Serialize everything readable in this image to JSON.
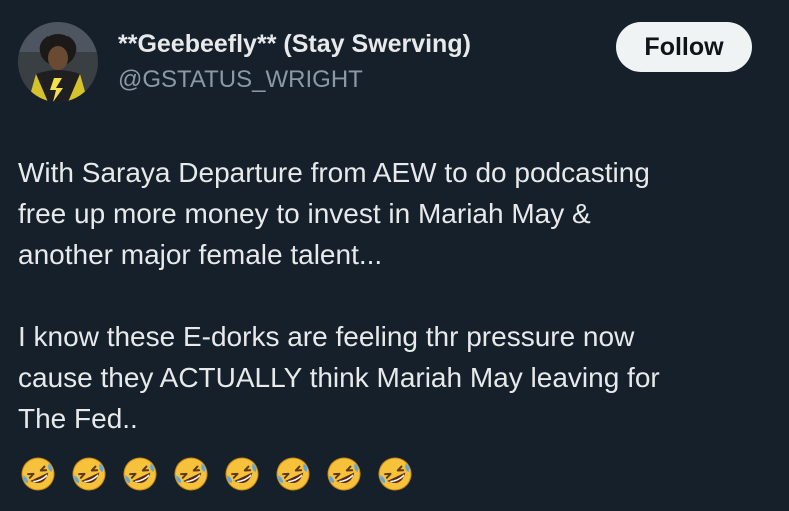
{
  "tweet": {
    "author": {
      "display_name": "**Geebeefly** (Stay Swerving)",
      "handle": "@GSTATUS_WRIGHT",
      "avatar_icon": "profile-avatar"
    },
    "follow_label": "Follow",
    "text_lines": [
      "With Saraya Departure from AEW to do podcasting",
      "free up more money to invest in Mariah May &",
      "another major female talent...",
      "",
      "I know these E-dorks are feeling thr pressure now",
      "cause they ACTUALLY think Mariah May leaving for",
      "The Fed.."
    ],
    "emoji": {
      "name": "rolling-on-the-floor-laughing",
      "count": 8
    }
  },
  "colors": {
    "background": "#16202b",
    "text_primary": "#e7e9ea",
    "text_secondary": "#8b98a5",
    "button_bg": "#eff3f4",
    "button_text": "#0f1419",
    "emoji_face": "#f7c23b"
  }
}
